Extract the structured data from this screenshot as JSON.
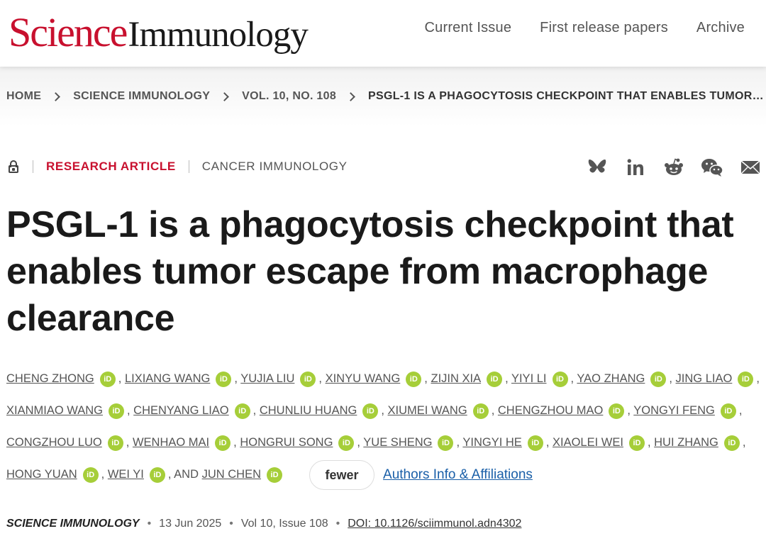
{
  "header": {
    "logo_science": "Science",
    "logo_journal": "Immunology",
    "nav": [
      "Current Issue",
      "First release papers",
      "Archive"
    ]
  },
  "breadcrumb": [
    "HOME",
    "SCIENCE IMMUNOLOGY",
    "VOL. 10, NO. 108",
    "PSGL-1 IS A PHAGOCYTOSIS CHECKPOINT THAT ENABLES TUMOR…"
  ],
  "article": {
    "access_icon": "lock-icon",
    "type": "RESEARCH ARTICLE",
    "subject": "CANCER IMMUNOLOGY",
    "share_icons": [
      "bluesky-icon",
      "linkedin-icon",
      "reddit-icon",
      "wechat-icon",
      "email-icon"
    ],
    "title": "PSGL-1 is a phagocytosis checkpoint that enables tumor escape from macrophage clearance",
    "authors": [
      "CHENG ZHONG",
      "LIXIANG WANG",
      "YUJIA LIU",
      "XINYU WANG",
      "ZIJIN XIA",
      "YIYI LI",
      "YAO ZHANG",
      "JING LIAO",
      "XIANMIAO WANG",
      "CHENYANG LIAO",
      "CHUNLIU HUANG",
      "XIUMEI WANG",
      "CHENGZHOU MAO",
      "YONGYI FENG",
      "CONGZHOU LUO",
      "WENHAO MAI",
      "HONGRUI SONG",
      "YUE SHENG",
      "YINGYI HE",
      "XIAOLEI WEI",
      "HUI ZHANG",
      "HONG YUAN",
      "WEI YI",
      "JUN CHEN"
    ],
    "orcid_label": "iD",
    "and_label": "AND",
    "fewer_label": "fewer",
    "affiliations_label": "Authors Info & Affiliations",
    "colors": {
      "accent": "#c8102e",
      "orcid": "#a6ce39",
      "link": "#1a5fa8"
    }
  },
  "citation": {
    "journal": "SCIENCE IMMUNOLOGY",
    "date": "13 Jun 2025",
    "volume": "Vol 10, Issue 108",
    "doi": "DOI: 10.1126/sciimmunol.adn4302"
  }
}
